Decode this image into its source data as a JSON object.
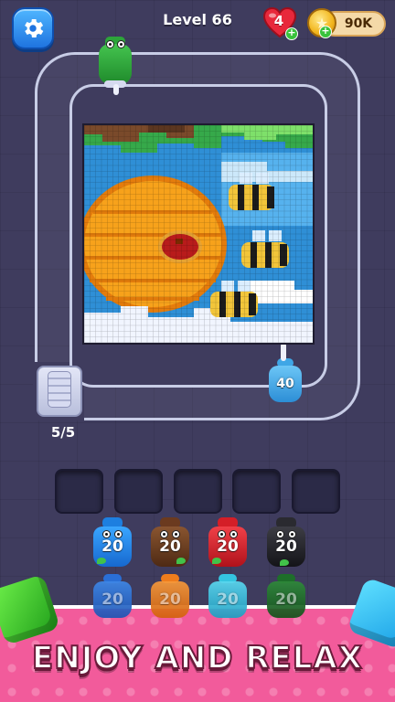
{
  "header": {
    "level": "Level 66",
    "lives": "4",
    "coins": "90K"
  },
  "board": {
    "queue_count": "5/5",
    "track_jar": {
      "count": "40",
      "color": "#4fb3f0"
    }
  },
  "jars": {
    "top_row": [
      {
        "count": "20",
        "color": "#1f8ff0"
      },
      {
        "count": "20",
        "color": "#6b3a1f"
      },
      {
        "count": "20",
        "color": "#e0232c"
      },
      {
        "count": "20",
        "color": "#222228"
      }
    ],
    "bottom_row": [
      {
        "count": "20",
        "color": "#2a6fd6"
      },
      {
        "count": "20",
        "color": "#ef7d1c"
      },
      {
        "count": "20",
        "color": "#34c4e0"
      },
      {
        "count": "20",
        "color": "#1e6e2a"
      }
    ]
  },
  "banner": {
    "text": "ENJOY AND RELAX"
  },
  "colors": {
    "background": "#3f3c5e",
    "banner": "#f25b9b",
    "accent_blue": "#1f74e0"
  },
  "icons": [
    "gear-icon",
    "heart-icon",
    "coin-icon",
    "plus-icon"
  ]
}
